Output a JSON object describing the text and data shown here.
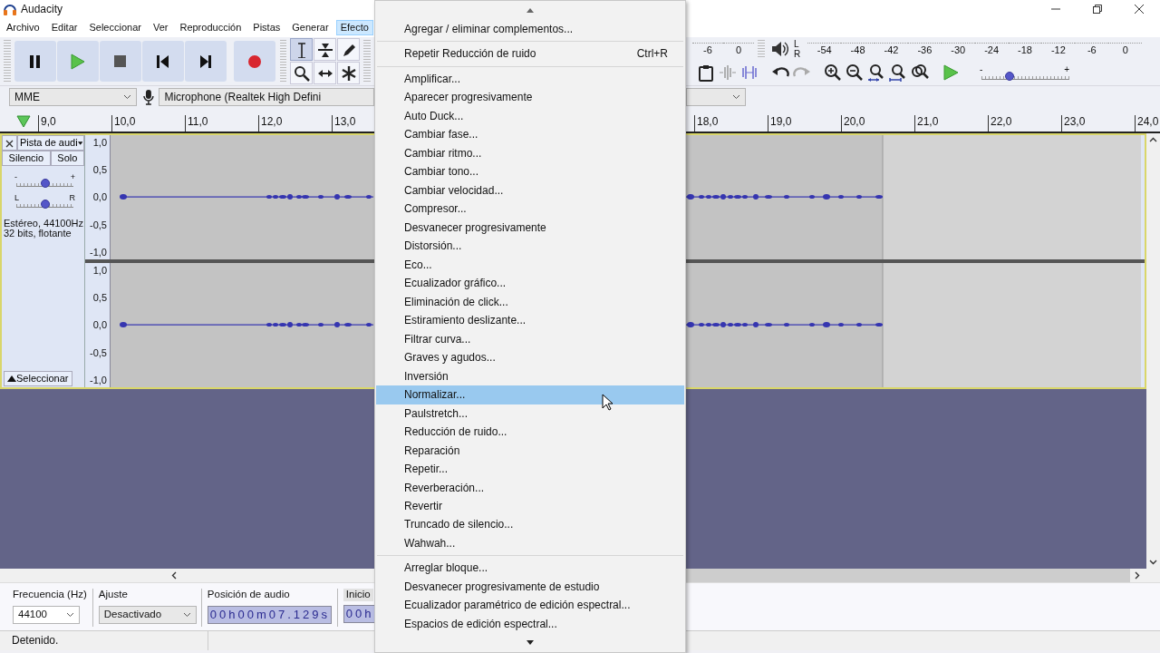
{
  "window": {
    "title": "Audacity"
  },
  "menu_bar": [
    {
      "label": "Archivo",
      "selected": false
    },
    {
      "label": "Editar",
      "selected": false
    },
    {
      "label": "Seleccionar",
      "selected": false
    },
    {
      "label": "Ver",
      "selected": false
    },
    {
      "label": "Reproducción",
      "selected": false
    },
    {
      "label": "Pistas",
      "selected": false
    },
    {
      "label": "Generar",
      "selected": false
    },
    {
      "label": "Efecto",
      "selected": true
    }
  ],
  "tools": [
    {
      "kind": "select",
      "selected": true
    },
    {
      "kind": "envelope",
      "selected": false
    },
    {
      "kind": "draw",
      "selected": false
    },
    {
      "kind": "zoom",
      "selected": false
    },
    {
      "kind": "timeshift",
      "selected": false
    },
    {
      "kind": "multi",
      "selected": false
    }
  ],
  "record_meter": {
    "ticks": [
      "-6",
      "0"
    ]
  },
  "playback_meter": {
    "channels": [
      "L",
      "R"
    ],
    "ticks": [
      "-54",
      "-48",
      "-42",
      "-36",
      "-30",
      "-24",
      "-18",
      "-12",
      "-6",
      "0"
    ]
  },
  "play_speed": {
    "min": "-",
    "max": "+",
    "level": 0.32
  },
  "device_bar": {
    "host": "MME",
    "input": "Microphone (Realtek High Defini"
  },
  "ruler": {
    "left_ticks": [
      "9,0",
      "10,0",
      "11,0",
      "12,0",
      "13,0"
    ],
    "right_ticks": [
      "18,0",
      "19,0",
      "20,0",
      "21,0",
      "22,0",
      "23,0",
      "24,0"
    ]
  },
  "track": {
    "name": "Pista de audi",
    "mute": "Silencio",
    "solo": "Solo",
    "gain": {
      "min": "-",
      "max": "+",
      "level": 0.5
    },
    "pan": {
      "min": "L",
      "max": "R",
      "level": 0.5
    },
    "info": [
      "Estéreo, 44100Hz",
      "32 bits, flotante"
    ],
    "select": "Seleccionar",
    "channels": [
      {
        "scale": [
          "1,0",
          "0,5",
          "0,0",
          "-0,5",
          "-1,0"
        ]
      },
      {
        "scale": [
          "1,0",
          "0,5",
          "0,0",
          "-0,5",
          "-1,0"
        ]
      }
    ]
  },
  "selection_toolbar": {
    "rate_label": "Frecuencia (Hz)",
    "rate": "44100",
    "snap_label": "Ajuste",
    "snap": "Desactivado",
    "position_label": "Posición de audio",
    "position": "00h00m07.129s",
    "start_label": "Inicio",
    "start": "00h"
  },
  "status_bar": {
    "text": "Detenido."
  },
  "effect_menu": {
    "sections": [
      [
        {
          "label": "Agregar / eliminar complementos...",
          "selected": false
        }
      ],
      [
        {
          "label": "Repetir Reducción de ruido",
          "shortcut": "Ctrl+R",
          "selected": false
        }
      ],
      [
        {
          "label": "Amplificar...",
          "selected": false
        },
        {
          "label": "Aparecer progresivamente",
          "selected": false
        },
        {
          "label": "Auto Duck...",
          "selected": false
        },
        {
          "label": "Cambiar fase...",
          "selected": false
        },
        {
          "label": "Cambiar ritmo...",
          "selected": false
        },
        {
          "label": "Cambiar tono...",
          "selected": false
        },
        {
          "label": "Cambiar velocidad...",
          "selected": false
        },
        {
          "label": "Compresor...",
          "selected": false
        },
        {
          "label": "Desvanecer progresivamente",
          "selected": false
        },
        {
          "label": "Distorsión...",
          "selected": false
        },
        {
          "label": "Eco...",
          "selected": false
        },
        {
          "label": "Ecualizador gráfico...",
          "selected": false
        },
        {
          "label": "Eliminación de click...",
          "selected": false
        },
        {
          "label": "Estiramiento deslizante...",
          "selected": false
        },
        {
          "label": "Filtrar curva...",
          "selected": false
        },
        {
          "label": "Graves y agudos...",
          "selected": false
        },
        {
          "label": "Inversión",
          "selected": false
        },
        {
          "label": "Normalizar...",
          "selected": true
        },
        {
          "label": "Paulstretch...",
          "selected": false
        },
        {
          "label": "Reducción de ruido...",
          "selected": false
        },
        {
          "label": "Reparación",
          "selected": false
        },
        {
          "label": "Repetir...",
          "selected": false
        },
        {
          "label": "Reverberación...",
          "selected": false
        },
        {
          "label": "Revertir",
          "selected": false
        },
        {
          "label": "Truncado de silencio...",
          "selected": false
        },
        {
          "label": "Wahwah...",
          "selected": false
        }
      ],
      [
        {
          "label": "Arreglar bloque...",
          "selected": false
        },
        {
          "label": "Desvanecer progresivamente de estudio",
          "selected": false
        },
        {
          "label": "Ecualizador paramétrico de edición espectral...",
          "selected": false
        },
        {
          "label": "Espacios de edición espectral...",
          "selected": false
        }
      ]
    ]
  }
}
